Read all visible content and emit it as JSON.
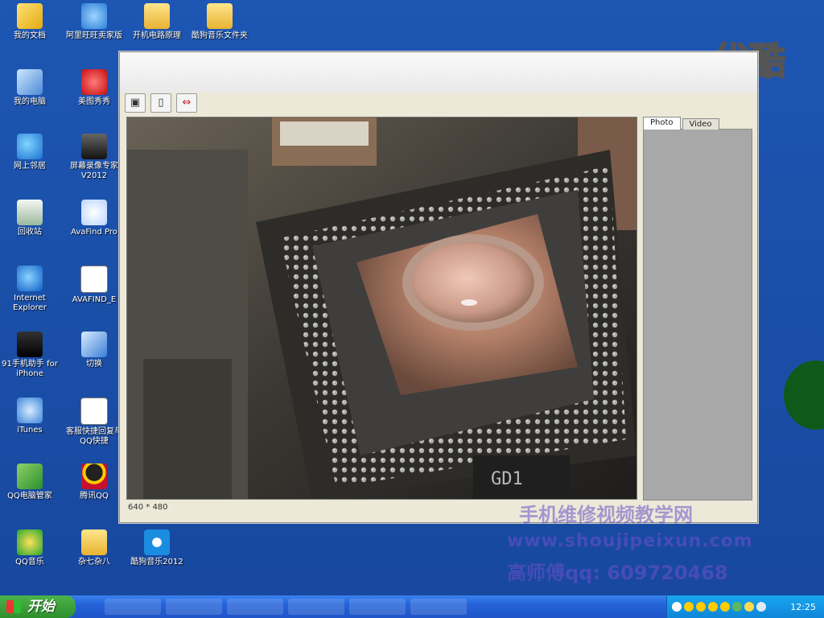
{
  "desktop": {
    "icons": [
      {
        "label": "我的文档",
        "icon": "documents-folder-icon"
      },
      {
        "label": "我的电脑",
        "icon": "my-computer-icon"
      },
      {
        "label": "网上邻居",
        "icon": "network-icon"
      },
      {
        "label": "回收站",
        "icon": "recycle-bin-icon"
      },
      {
        "label": "Internet Explorer",
        "icon": "ie-icon"
      },
      {
        "label": "91手机助手 for iPhone",
        "icon": "phone-icon"
      },
      {
        "label": "iTunes",
        "icon": "itunes-icon"
      },
      {
        "label": "QQ电脑管家",
        "icon": "shield-icon"
      },
      {
        "label": "QQ音乐",
        "icon": "qq-music-icon"
      },
      {
        "label": "阿里旺旺卖家版",
        "icon": "aliwangwang-icon"
      },
      {
        "label": "美图秀秀",
        "icon": "meitu-icon"
      },
      {
        "label": "屏幕录像专家V2012",
        "icon": "screen-recorder-icon"
      },
      {
        "label": "AvaFind Pro",
        "icon": "avafind-icon"
      },
      {
        "label": "AVAFIND_E",
        "icon": "document-icon"
      },
      {
        "label": "切换",
        "icon": "switch-icon"
      },
      {
        "label": "客服快捷回复与QQ快捷",
        "icon": "document-icon"
      },
      {
        "label": "腾讯QQ",
        "icon": "qq-penguin-icon"
      },
      {
        "label": "杂七杂八",
        "icon": "folder-icon"
      },
      {
        "label": "开机电路原理",
        "icon": "folder-icon"
      },
      {
        "label": "酷狗音乐文件夹",
        "icon": "folder-icon"
      },
      {
        "label": "酷狗音乐2012",
        "icon": "kugou-icon"
      }
    ]
  },
  "brand_logo": "优酷",
  "app": {
    "toolbar": {
      "snapshot_icon": "camera-icon",
      "record_icon": "video-camera-icon",
      "fullscreen_icon": "fullscreen-icon"
    },
    "status": "640 * 480",
    "tabs": [
      "Photo",
      "Video"
    ],
    "active_tab": "Photo"
  },
  "watermark": {
    "line1": "手机维修视频教学网",
    "line2": "www.shoujipeixun.com",
    "line3": "高师傅qq: 609720468"
  },
  "taskbar": {
    "start_label": "开始",
    "clock": "12:25"
  },
  "colors": {
    "desktop": "#1a4fa8",
    "taskbar": "#2462d8",
    "start_button": "#3a9c37",
    "tray": "#1298e6"
  }
}
